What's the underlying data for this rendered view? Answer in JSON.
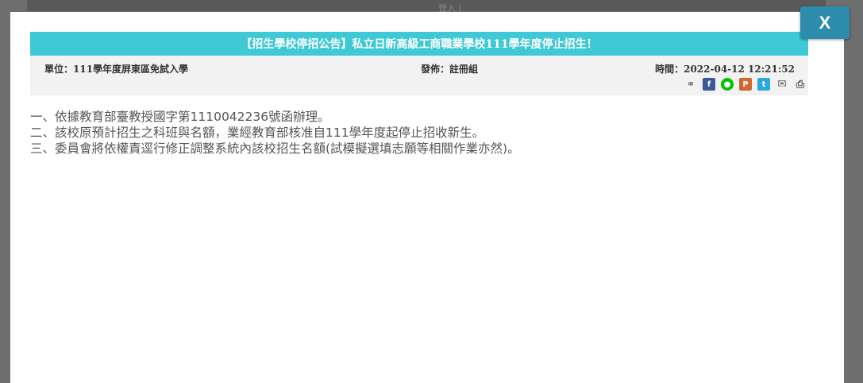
{
  "background": {
    "top_text": "登入 |"
  },
  "dialog": {
    "close_label": "X",
    "title": "【招生學校停招公告】私立日新高級工商職業學校111學年度停止招生！",
    "unit": "單位：111學年度屏東區免試入學",
    "publisher": "發佈：註冊組",
    "time": "時間：2022-04-12 12:21:52",
    "share_icons": [
      "link-icon",
      "facebook-icon",
      "line-icon",
      "plurk-icon",
      "twitter-icon",
      "email-icon",
      "print-icon"
    ],
    "paragraphs": [
      "一、依據教育部臺教授國字第1110042236號函辦理。",
      "二、該校原預計招生之科班與名額，業經教育部核准自111學年度起停止招收新生。",
      "三、委員會將依權責逕行修正調整系統內該校招生名額(試模擬選填志願等相關作業亦然)。"
    ]
  },
  "colors": {
    "title_bar": "#3fc8d6",
    "close_button": "#2d8cab",
    "meta_background": "#f2f2f2",
    "overlay": "#6e6e6e"
  }
}
